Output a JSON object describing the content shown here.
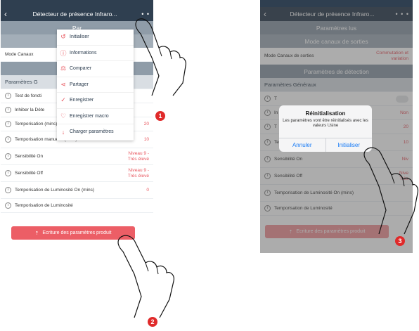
{
  "left": {
    "title": "Détecteur de présence Infraro...",
    "more": "• •",
    "sections": {
      "s1": "Par",
      "s2": "Mode c",
      "row_mode": "Mode Canaux",
      "s3": "Paramè",
      "sub": "Paramètres G"
    },
    "rows": [
      {
        "label": "Test de foncti",
        "value": ""
      },
      {
        "label": "Inhiber la Déte",
        "value": ""
      },
      {
        "label": "Temporisation (mins)",
        "value": "20"
      },
      {
        "label": "Temporisation manuelle (mins)",
        "value": "10"
      },
      {
        "label": "Sensibilité On",
        "value": "Niveau 9 - Très élevé"
      },
      {
        "label": "Sensibilité Off",
        "value": "Niveau 9 - Très élevé"
      },
      {
        "label": "Temporisation de Luminosité On  (mins)",
        "value": "0"
      },
      {
        "label": "Temporisation de Luminosité",
        "value": ""
      }
    ],
    "write_button": "Ecriture des paramètres produit",
    "menu": [
      {
        "label": "Initialiser",
        "icon": "↺"
      },
      {
        "label": "Informations",
        "icon": "ⓘ"
      },
      {
        "label": "Comparer",
        "icon": "⚖"
      },
      {
        "label": "Partager",
        "icon": "⋖"
      },
      {
        "label": "Enregistrer",
        "icon": "✓"
      },
      {
        "label": "Enregistrer macro",
        "icon": "♡"
      },
      {
        "label": "Charger paramètres",
        "icon": "↓"
      }
    ]
  },
  "right": {
    "title": "Détecteur de présence Infraro...",
    "more": "• • •",
    "sec_params_lus": "Paramètres lus",
    "sec_mode": "Mode canaux de sorties",
    "row_mode_label": "Mode Canaux de sorties",
    "row_mode_value": "Commutation et variation",
    "sec_detection": "Paramètres de détection",
    "sub_general": "Paramètres Généraux",
    "rows": [
      {
        "label": "T",
        "value": ""
      },
      {
        "label": "In",
        "value": "Non"
      },
      {
        "label": "T",
        "value": "20"
      },
      {
        "label": "Temporisation manuelle (mins)",
        "value": "10"
      },
      {
        "label": "Sensibilité On",
        "value": "Niv"
      },
      {
        "label": "Sensibilité Off",
        "value": "Nive Très"
      },
      {
        "label": "Temporisation de Luminosité On  (mins)",
        "value": ""
      },
      {
        "label": "Temporisation de Luminosité",
        "value": ""
      }
    ],
    "write_button": "Ecriture des paramètres produit",
    "alert": {
      "title": "Réinitialisation",
      "message": "Les paramètres vont être réinitialisés avec les valeurs Usine",
      "cancel": "Annuler",
      "confirm": "Initialiser"
    }
  },
  "badges": {
    "one": "1",
    "two": "2",
    "three": "3"
  },
  "colors": {
    "navbar": "#2f3f50",
    "accent": "#e8565e",
    "section": "#8f9ca8",
    "button": "#ec5e66",
    "ios_blue": "#1a7cf5",
    "badge": "#e02a2a"
  }
}
